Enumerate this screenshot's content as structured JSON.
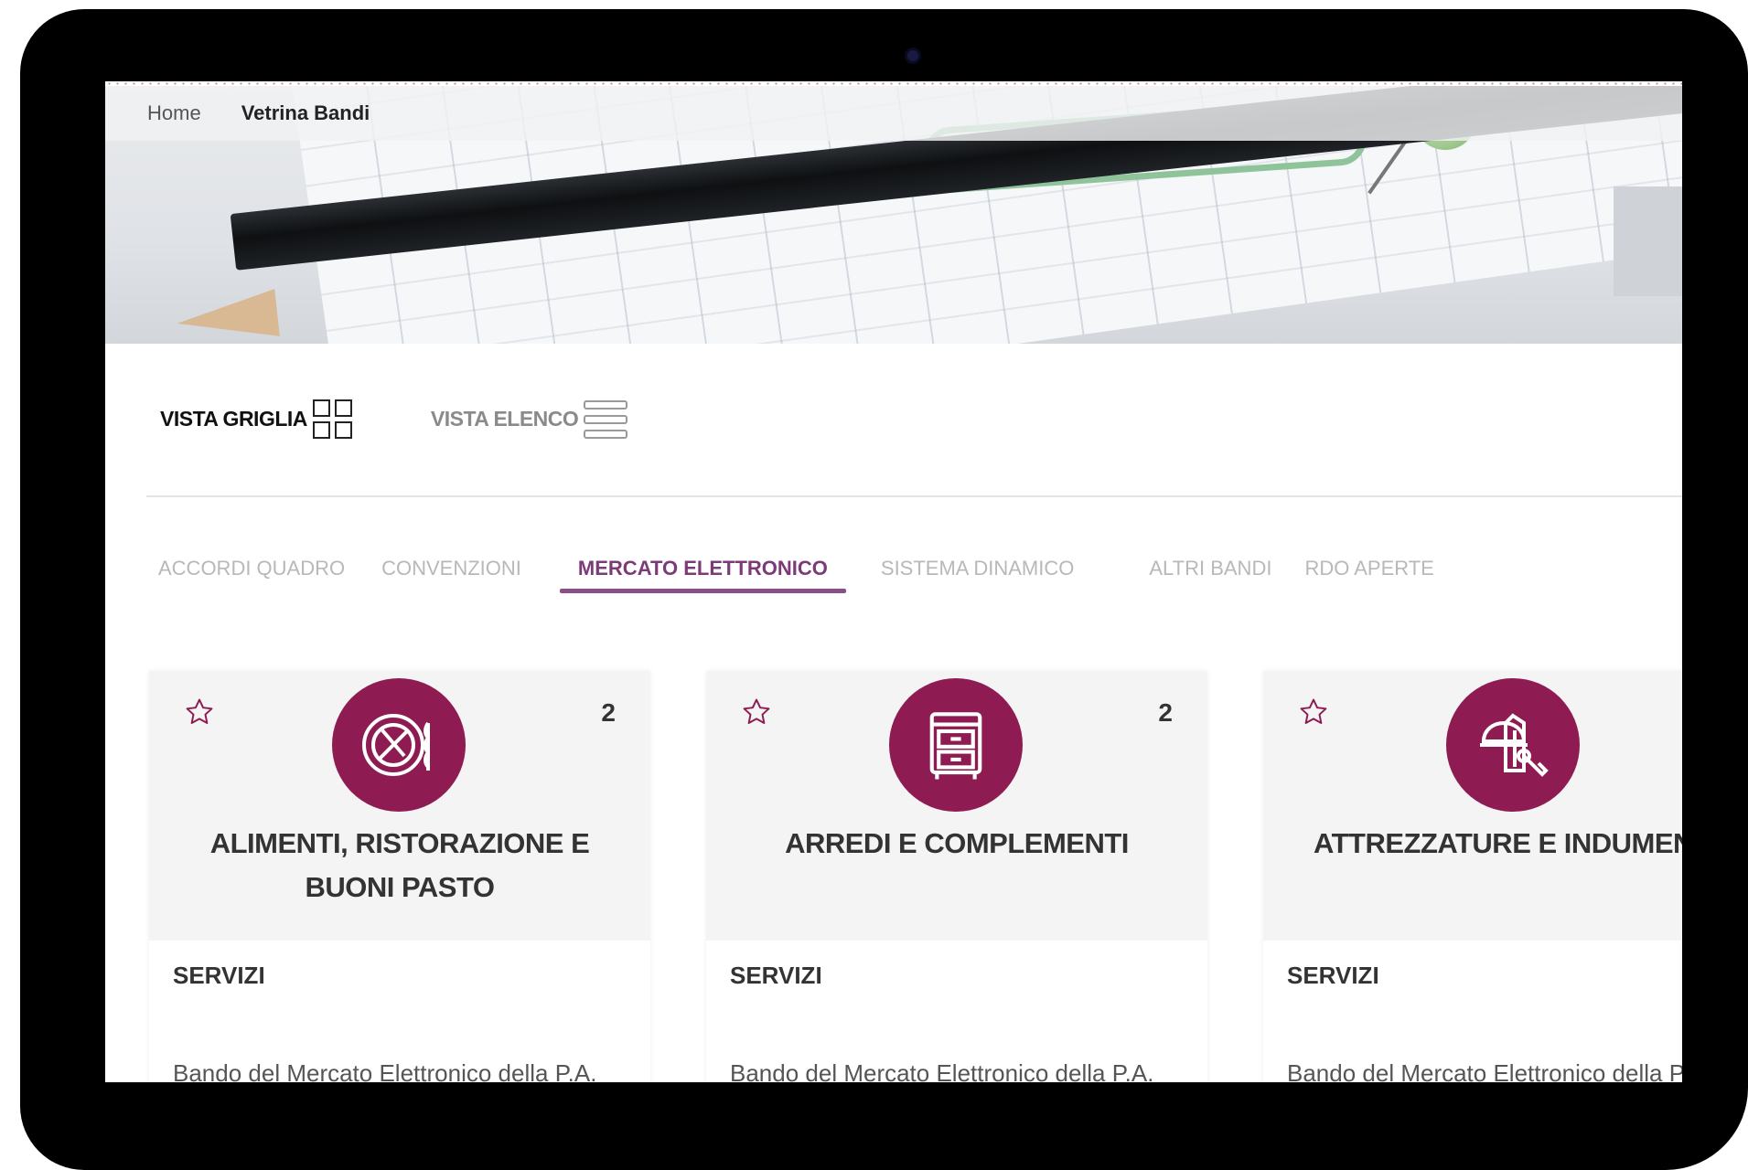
{
  "breadcrumb": {
    "home": "Home",
    "current": "Vetrina Bandi"
  },
  "views": {
    "grid_label": "VISTA GRIGLIA",
    "list_label": "VISTA ELENCO"
  },
  "tabs": [
    {
      "label": "ACCORDI QUADRO",
      "active": false
    },
    {
      "label": "CONVENZIONI",
      "active": false
    },
    {
      "label": "MERCATO ELETTRONICO",
      "active": true
    },
    {
      "label": "SISTEMA DINAMICO",
      "active": false
    },
    {
      "label": "ALTRI BANDI",
      "active": false
    },
    {
      "label": "RDO APERTE",
      "active": false
    }
  ],
  "cards": [
    {
      "title": "ALIMENTI, RISTORAZIONE E BUONI PASTO",
      "count": "2",
      "category": "SERVIZI",
      "description": "Bando del Mercato Elettronico della P.A.",
      "icon": "food-plate-icon"
    },
    {
      "title": "ARREDI E COMPLEMENTI",
      "count": "2",
      "category": "SERVIZI",
      "description": "Bando del Mercato Elettronico della P.A.",
      "icon": "drawer-cabinet-icon"
    },
    {
      "title": "ATTREZZATURE E INDUMENTI",
      "count": "",
      "category": "SERVIZI",
      "description": "Bando del Mercato Elettronico della P.A.",
      "icon": "tools-uniform-icon"
    }
  ],
  "colors": {
    "accent": "#8e1c52",
    "tab_active": "#7d3a78"
  }
}
